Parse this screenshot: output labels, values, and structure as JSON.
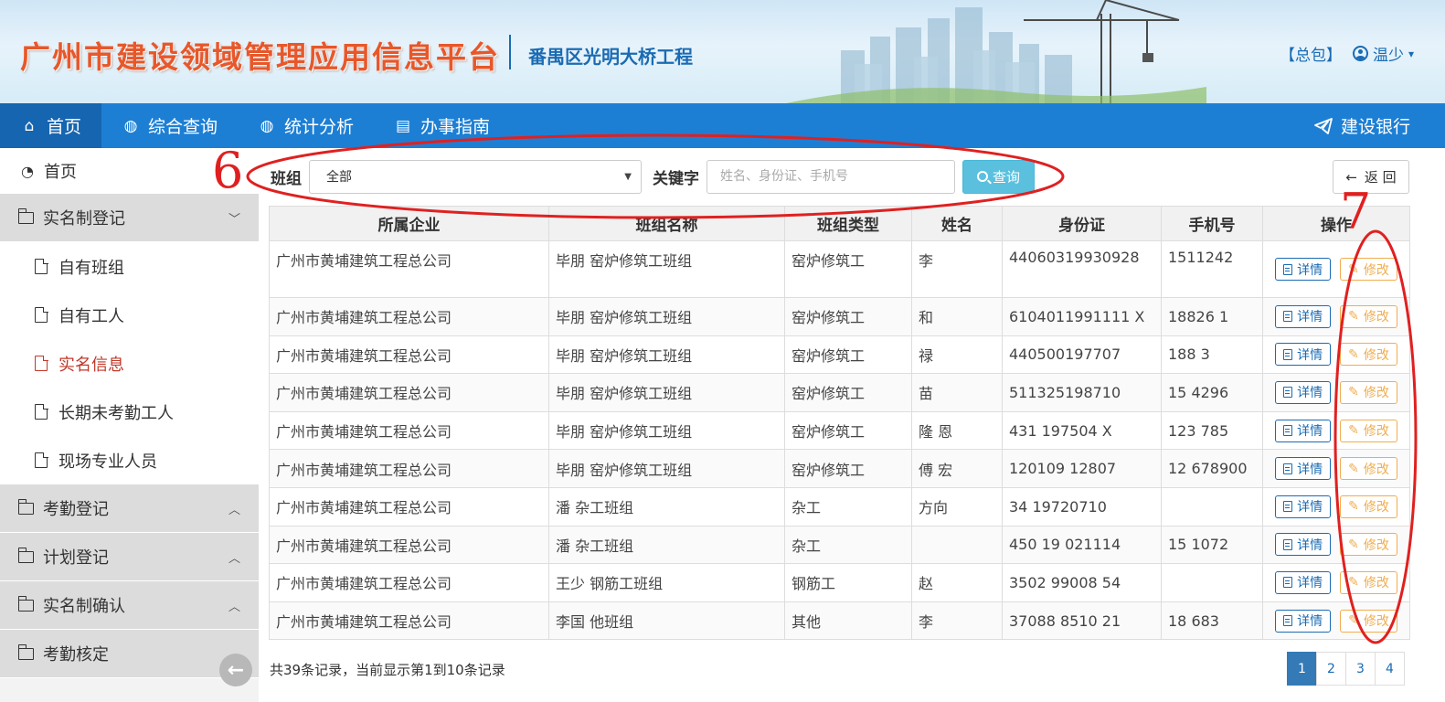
{
  "header": {
    "app_title": "广州市建设领域管理应用信息平台",
    "project_name": "番禺区光明大桥工程",
    "role_badge": "【总包】",
    "username": "温少",
    "user_icon": "user-circle-icon"
  },
  "topnav": {
    "items": [
      {
        "label": "首页",
        "icon": "home-icon",
        "glyph": "⌂"
      },
      {
        "label": "综合查询",
        "icon": "globe-icon",
        "glyph": "◍"
      },
      {
        "label": "统计分析",
        "icon": "globe-icon",
        "glyph": "◍"
      },
      {
        "label": "办事指南",
        "icon": "book-icon",
        "glyph": "▤"
      }
    ],
    "right_label": "建设银行",
    "right_icon": "paper-plane-icon"
  },
  "sidebar": {
    "home": "首页",
    "group_realname": "实名制登记",
    "sub_items": [
      "自有班组",
      "自有工人",
      "实名信息",
      "长期未考勤工人",
      "现场专业人员"
    ],
    "groups": [
      "考勤登记",
      "计划登记",
      "实名制确认",
      "考勤核定"
    ]
  },
  "filter": {
    "team_label": "班组",
    "team_selected": "全部",
    "keyword_label": "关键字",
    "keyword_placeholder": "姓名、身份证、手机号",
    "search_label": "查询",
    "return_label": "返 回"
  },
  "table": {
    "columns": [
      "所属企业",
      "班组名称",
      "班组类型",
      "姓名",
      "身份证",
      "手机号",
      "操作"
    ],
    "detail_label": "详情",
    "edit_label": "修改",
    "rows": [
      {
        "company": "广州市黄埔建筑工程总公司",
        "team": "毕朋 窑炉修筑工班组",
        "type": "窑炉修筑工",
        "name": "李",
        "id": "44060319930928",
        "phone": "1511242"
      },
      {
        "company": "广州市黄埔建筑工程总公司",
        "team": "毕朋 窑炉修筑工班组",
        "type": "窑炉修筑工",
        "name": "和",
        "id": "6104011991111 X",
        "phone": "18826 1"
      },
      {
        "company": "广州市黄埔建筑工程总公司",
        "team": "毕朋 窑炉修筑工班组",
        "type": "窑炉修筑工",
        "name": "禄",
        "id": "440500197707",
        "phone": "188 3"
      },
      {
        "company": "广州市黄埔建筑工程总公司",
        "team": "毕朋 窑炉修筑工班组",
        "type": "窑炉修筑工",
        "name": "苗",
        "id": "511325198710",
        "phone": "15 4296"
      },
      {
        "company": "广州市黄埔建筑工程总公司",
        "team": "毕朋 窑炉修筑工班组",
        "type": "窑炉修筑工",
        "name": "隆 恩",
        "id": "431 197504 X",
        "phone": "123 785"
      },
      {
        "company": "广州市黄埔建筑工程总公司",
        "team": "毕朋 窑炉修筑工班组",
        "type": "窑炉修筑工",
        "name": "傅 宏",
        "id": "120109 12807",
        "phone": "12 678900"
      },
      {
        "company": "广州市黄埔建筑工程总公司",
        "team": "潘 杂工班组",
        "type": "杂工",
        "name": "方向",
        "id": "34 19720710",
        "phone": ""
      },
      {
        "company": "广州市黄埔建筑工程总公司",
        "team": "潘 杂工班组",
        "type": "杂工",
        "name": "",
        "id": "450 19 021114",
        "phone": "15 1072"
      },
      {
        "company": "广州市黄埔建筑工程总公司",
        "team": "王少 钢筋工班组",
        "type": "钢筋工",
        "name": "赵",
        "id": "3502 99008 54",
        "phone": ""
      },
      {
        "company": "广州市黄埔建筑工程总公司",
        "team": "李国 他班组",
        "type": "其他",
        "name": "李",
        "id": "37088 8510 21",
        "phone": "18 683"
      }
    ]
  },
  "footer": {
    "record_info": "共39条记录，当前显示第1到10条记录",
    "pages": [
      "1",
      "2",
      "3",
      "4"
    ],
    "current_page": "1"
  },
  "annotations": {
    "label_6": "6",
    "label_7": "7",
    "color": "#e02020"
  },
  "colors": {
    "nav_blue": "#1d7fd4",
    "title_orange": "#e8572a",
    "link_blue": "#1a6bb3",
    "info_button": "#5bc0de",
    "edit_orange": "#f0ad4e"
  }
}
